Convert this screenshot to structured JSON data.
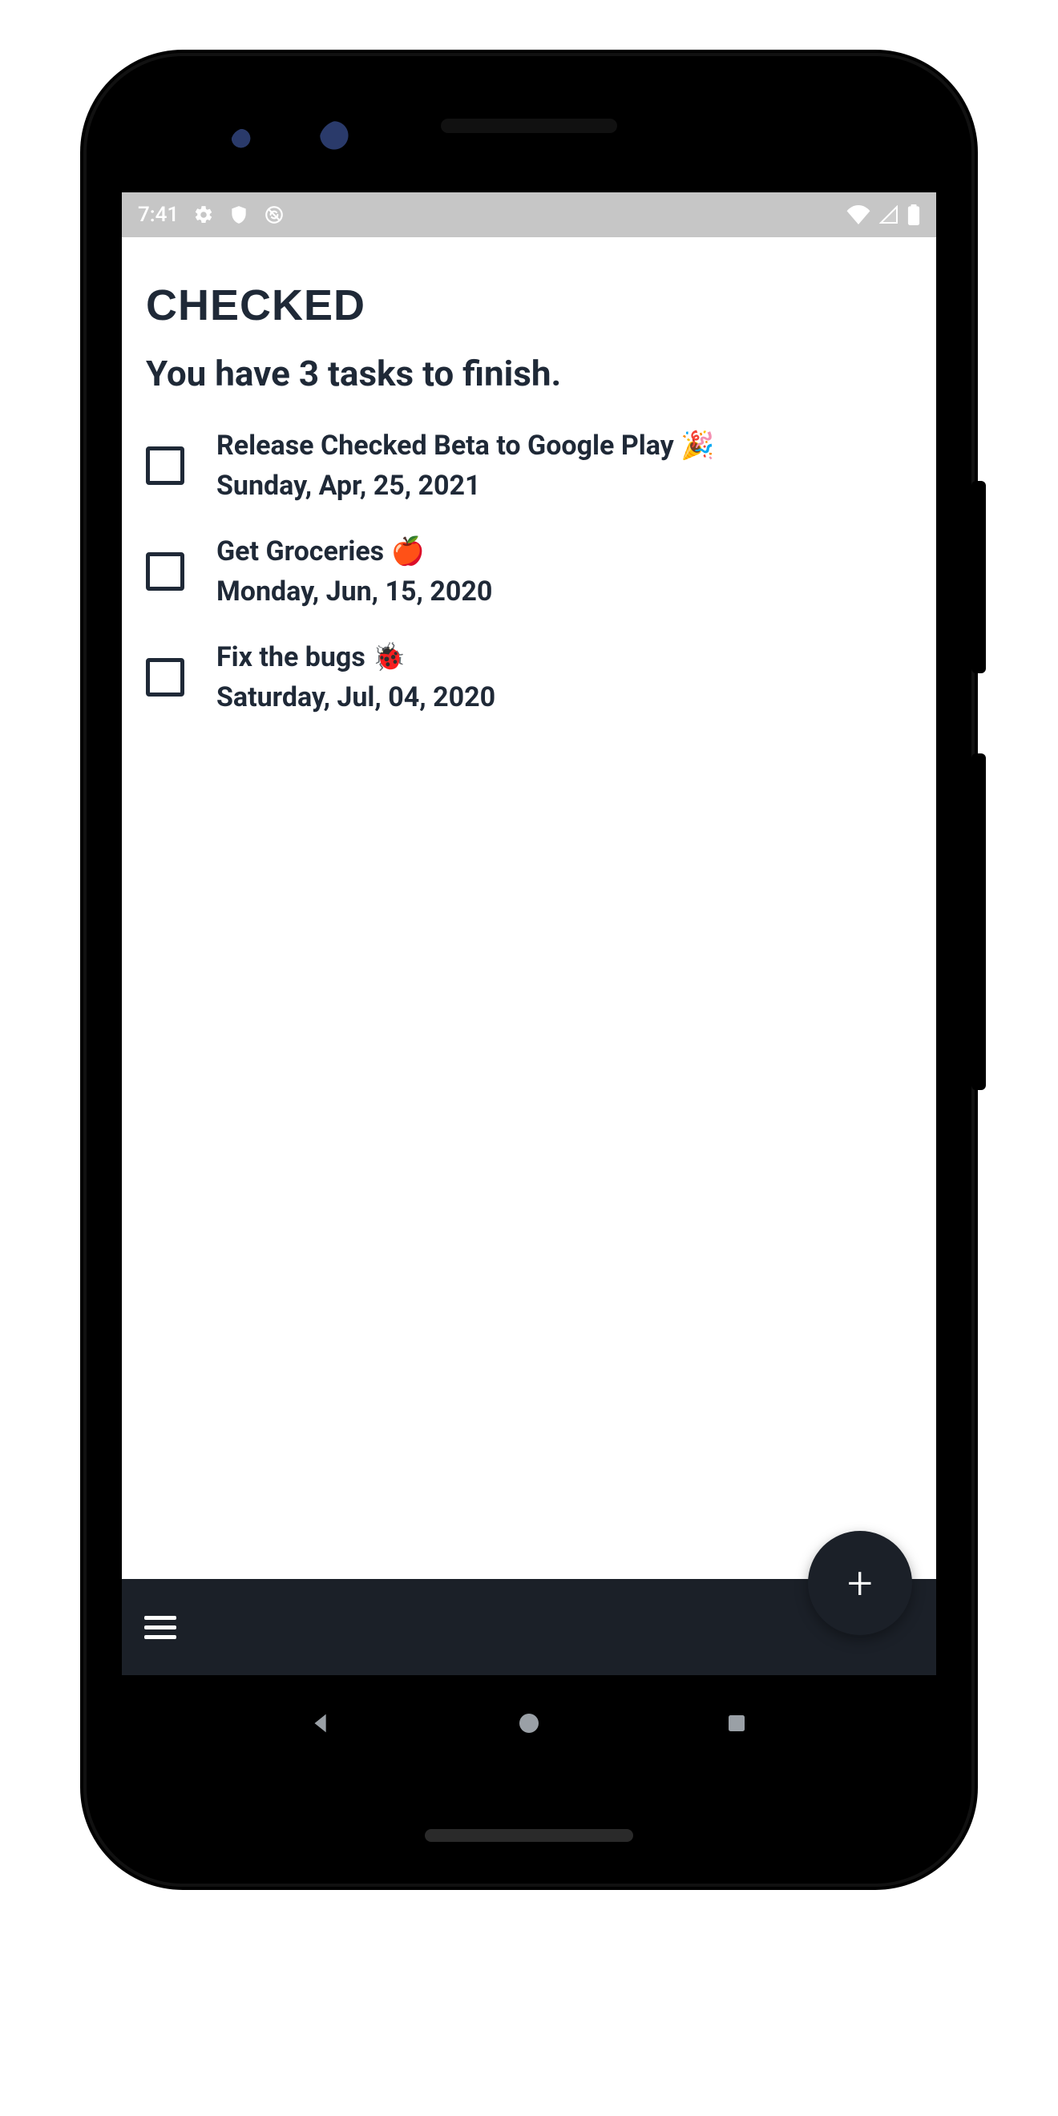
{
  "statusbar": {
    "time": "7:41"
  },
  "app": {
    "title": "CHECKED",
    "subtitle": "You have 3 tasks to finish.",
    "tasks": [
      {
        "title": "Release Checked Beta to Google Play 🎉",
        "date": "Sunday, Apr, 25, 2021",
        "checked": false
      },
      {
        "title": "Get Groceries 🍎",
        "date": "Monday, Jun, 15, 2020",
        "checked": false
      },
      {
        "title": "Fix the bugs 🐞",
        "date": "Saturday, Jul, 04, 2020",
        "checked": false
      }
    ]
  },
  "icons": {
    "fab_plus": "+"
  }
}
